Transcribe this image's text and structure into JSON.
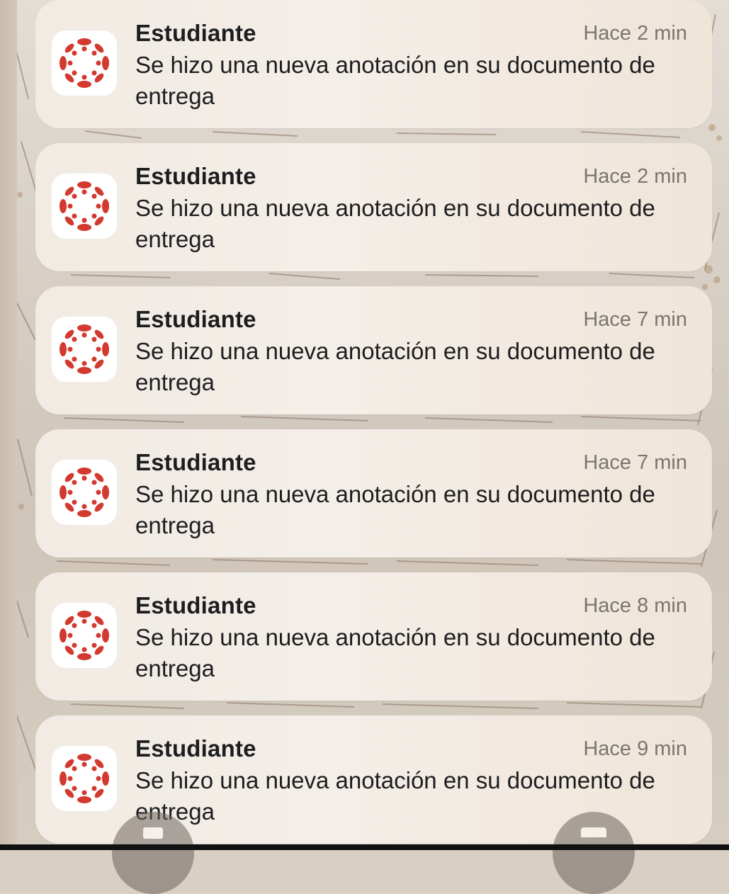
{
  "notifications": [
    {
      "app": "Estudiante",
      "time": "Hace 2 min",
      "message": "Se hizo una nueva anotación en su documento de entrega"
    },
    {
      "app": "Estudiante",
      "time": "Hace 2 min",
      "message": "Se hizo una nueva anotación en su documento de entrega"
    },
    {
      "app": "Estudiante",
      "time": "Hace 7 min",
      "message": "Se hizo una nueva anotación en su documento de entrega"
    },
    {
      "app": "Estudiante",
      "time": "Hace 7 min",
      "message": "Se hizo una nueva anotación en su documento de entrega"
    },
    {
      "app": "Estudiante",
      "time": "Hace 8 min",
      "message": "Se hizo una nueva anotación en su documento de entrega"
    },
    {
      "app": "Estudiante",
      "time": "Hace 9 min",
      "message": "Se hizo una nueva anotación en su documento de entrega"
    }
  ],
  "icons": {
    "app_icon": "canvas-student-icon",
    "flashlight": "flashlight-icon",
    "camera": "camera-icon"
  },
  "colors": {
    "brand": "#d33a2f",
    "title_text": "#1d1d1f",
    "time_text": "#7c7670"
  }
}
